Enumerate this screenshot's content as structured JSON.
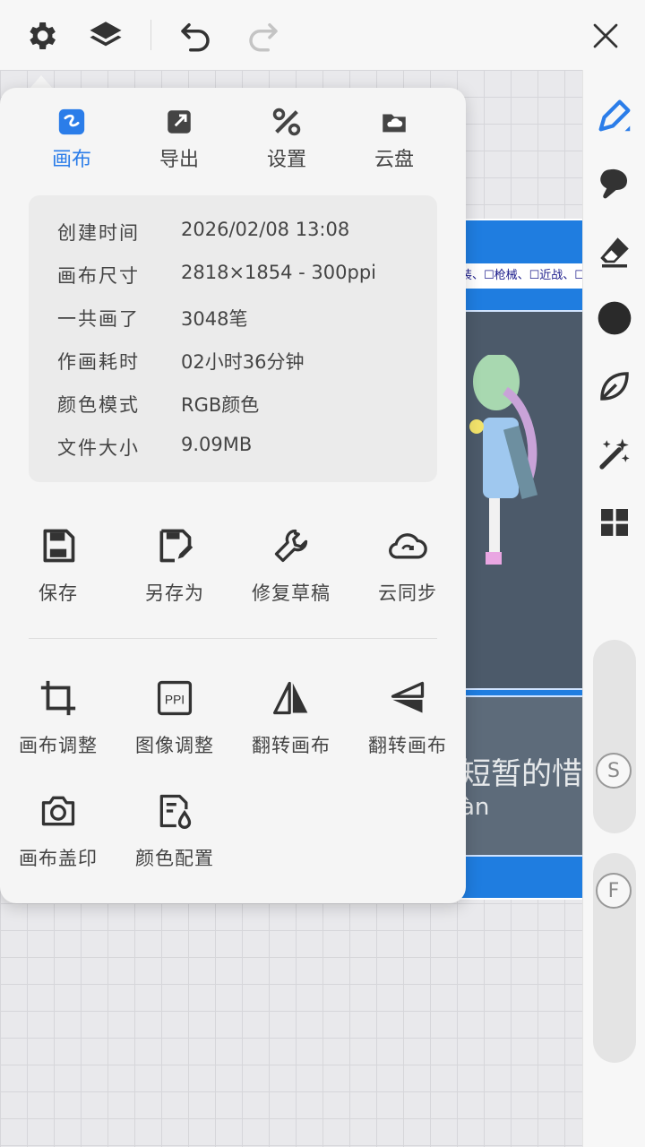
{
  "toolbar": {
    "icons": [
      "gear-icon",
      "layers-icon",
      "undo-icon",
      "redo-icon",
      "close-icon"
    ]
  },
  "tabs": [
    {
      "label": "画布",
      "icon": "canvas-icon",
      "active": true
    },
    {
      "label": "导出",
      "icon": "export-icon",
      "active": false
    },
    {
      "label": "设置",
      "icon": "settings-tools-icon",
      "active": false
    },
    {
      "label": "云盘",
      "icon": "cloud-drive-icon",
      "active": false
    }
  ],
  "info": [
    {
      "key": "创建时间",
      "value": "2026/02/08 13:08"
    },
    {
      "key": "画布尺寸",
      "value": "2818×1854 - 300ppi"
    },
    {
      "key": "一共画了",
      "value": "3048笔"
    },
    {
      "key": "作画耗时",
      "value": "02小时36分钟"
    },
    {
      "key": "颜色模式",
      "value": "RGB颜色"
    },
    {
      "key": "文件大小",
      "value": "9.09MB"
    }
  ],
  "actions_row1": [
    {
      "label": "保存",
      "icon": "save-icon"
    },
    {
      "label": "另存为",
      "icon": "save-as-icon"
    },
    {
      "label": "修复草稿",
      "icon": "wrench-icon"
    },
    {
      "label": "云同步",
      "icon": "cloud-sync-icon"
    }
  ],
  "actions_row2": [
    {
      "label": "画布调整",
      "icon": "crop-icon"
    },
    {
      "label": "图像调整",
      "icon": "ppi-icon"
    },
    {
      "label": "翻转画布",
      "icon": "flip-horizontal-icon"
    },
    {
      "label": "翻转画布",
      "icon": "flip-vertical-icon"
    }
  ],
  "actions_row3": [
    {
      "label": "画布盖印",
      "icon": "camera-icon"
    },
    {
      "label": "颜色配置",
      "icon": "color-profile-icon"
    }
  ],
  "artwork": {
    "strip_text": "装、☐枪械、☐近战、☐",
    "hand_text": "短暂的惜",
    "hand_text2": "àn"
  },
  "rail": {
    "slider_s_label": "S",
    "slider_f_label": "F"
  },
  "colors": {
    "accent": "#2b7de9",
    "panel": "#f5f5f5",
    "info_bg": "#ebebeb"
  }
}
